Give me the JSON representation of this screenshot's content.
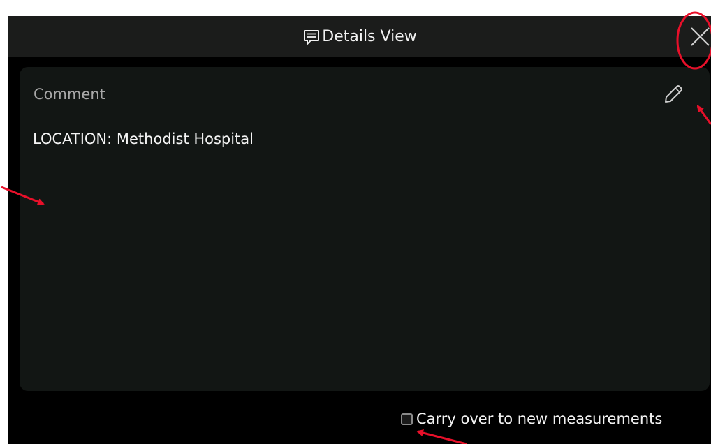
{
  "dialog": {
    "title": "Details View",
    "title_icon": "comment-icon",
    "close_icon": "close-icon"
  },
  "comment": {
    "label": "Comment",
    "edit_icon": "pencil-icon",
    "text": "LOCATION: Methodist Hospital"
  },
  "options": {
    "carry_over_label": "Carry over to new measurements",
    "carry_over_checked": false
  },
  "annotation_color": "#e8102a"
}
